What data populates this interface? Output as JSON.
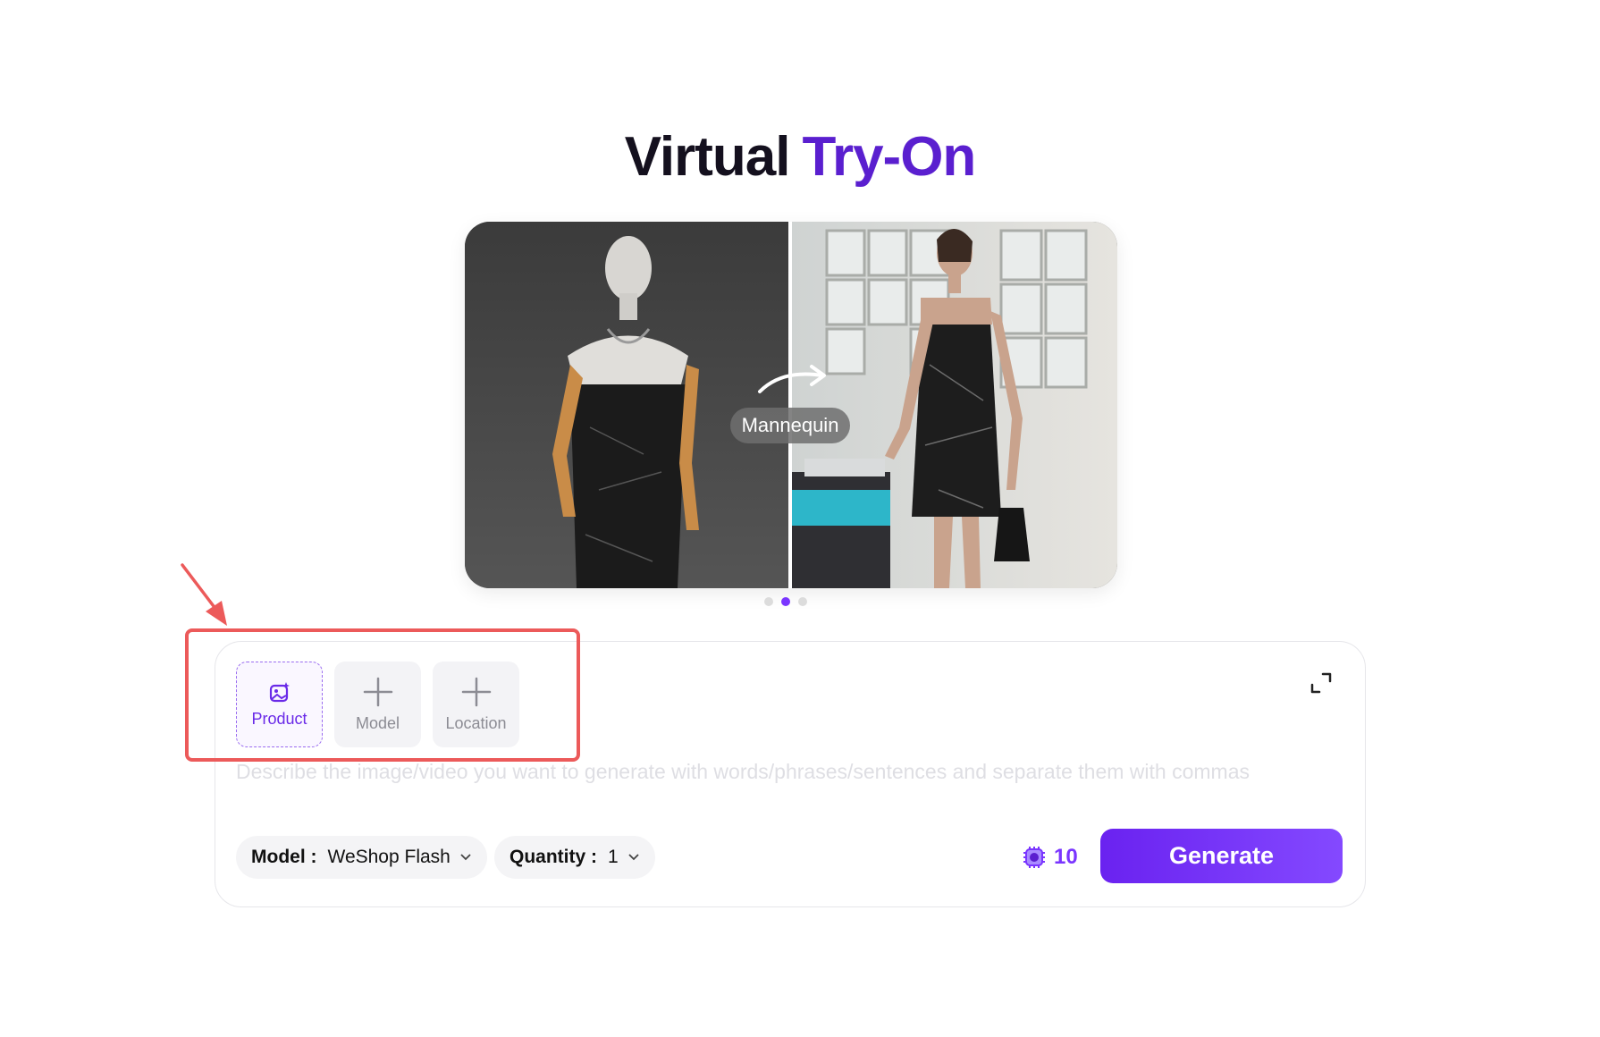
{
  "header": {
    "title_part1": "Virtual",
    "title_part2": "Try-On"
  },
  "hero": {
    "label": "Mannequin",
    "carousel_count": 3,
    "carousel_active": 2
  },
  "inputs": {
    "slots": [
      {
        "label": "Product",
        "icon": "image-sparkle-icon",
        "selected": true
      },
      {
        "label": "Model",
        "icon": "plus-icon",
        "selected": false
      },
      {
        "label": "Location",
        "icon": "plus-icon",
        "selected": false
      }
    ],
    "prompt_placeholder": "Describe the image/video you want to generate with words/phrases/sentences and separate them with commas"
  },
  "controls": {
    "model_label": "Model :",
    "model_value": "WeShop Flash",
    "quantity_label": "Quantity :",
    "quantity_value": "1",
    "credits": "10",
    "generate_label": "Generate"
  },
  "colors": {
    "accent": "#7a35ff",
    "title_accent": "#5a1fcf",
    "annotation": "#ec5a5a"
  }
}
